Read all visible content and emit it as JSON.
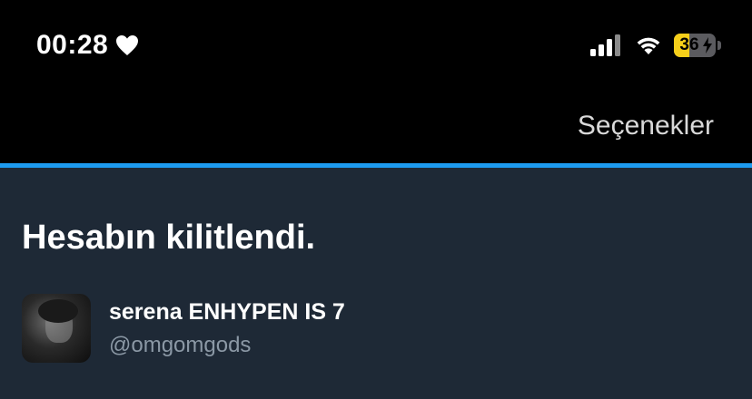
{
  "status_bar": {
    "time": "00:28",
    "icons": [
      "heart-icon",
      "signal-icon",
      "wifi-icon",
      "battery-icon",
      "bolt-icon"
    ],
    "battery_level": "36",
    "battery_fraction": 0.36
  },
  "header": {
    "options_label": "Seçenekler"
  },
  "main": {
    "title": "Hesabın kilitlendi.",
    "account": {
      "display_name": "serena ENHYPEN IS 7",
      "username": "@omgomgods"
    }
  },
  "colors": {
    "top_background": "#000000",
    "page_background": "#1e2936",
    "accent": "#1d9bf0",
    "battery_fill": "#f6cf1a",
    "secondary_text": "#8b98a5"
  }
}
